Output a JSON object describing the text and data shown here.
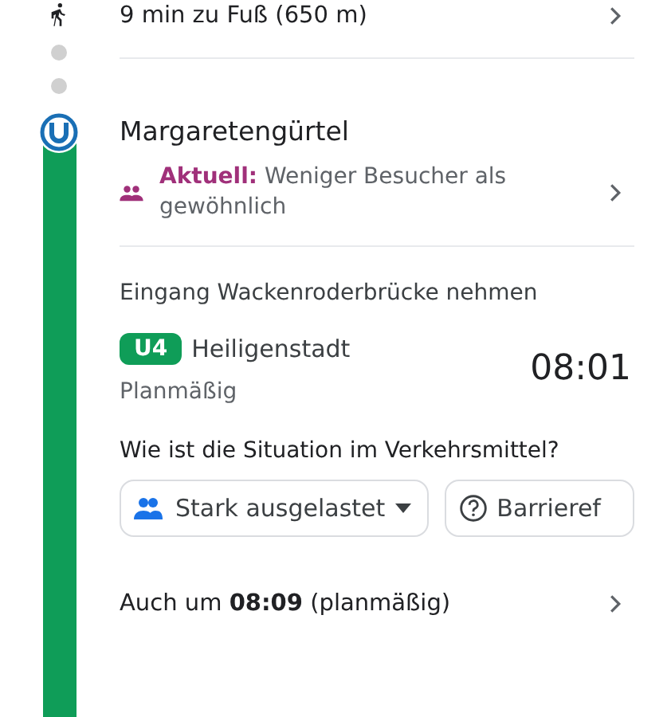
{
  "walk": {
    "text": "9 min zu Fuß (650 m)"
  },
  "station": {
    "name": "Margaretengürtel",
    "crowd": {
      "label": "Aktuell:",
      "text": "Weniger Besucher als gewöhnlich"
    }
  },
  "entrance": "Eingang Wackenroderbrücke nehmen",
  "departure": {
    "line": "U4",
    "color": "#0f9d58",
    "destination": "Heiligenstadt",
    "status": "Planmäßig",
    "time": "08:01"
  },
  "question": "Wie ist die Situation im Verkehrsmittel?",
  "chips": [
    {
      "kind": "crowding",
      "label": "Stark ausgelastet"
    },
    {
      "kind": "help",
      "label": "Barrieref"
    }
  ],
  "also": "Auch um **08:09** (planmäßig)"
}
